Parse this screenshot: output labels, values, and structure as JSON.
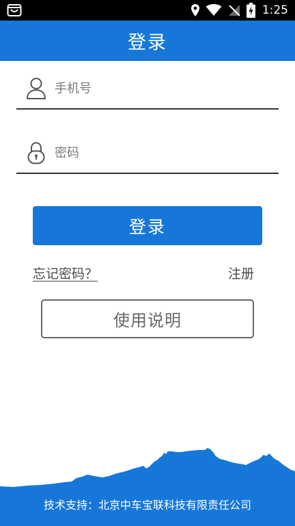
{
  "status_bar": {
    "time": "1:25",
    "icons": [
      "shopping-bag-icon",
      "location-icon",
      "wifi-icon",
      "no-signal-icon",
      "battery-charging-icon"
    ]
  },
  "app_bar": {
    "title": "登录"
  },
  "form": {
    "phone": {
      "placeholder": "手机号",
      "value": "",
      "icon": "user-icon"
    },
    "password": {
      "placeholder": "密码",
      "value": "",
      "icon": "lock-icon"
    }
  },
  "actions": {
    "login_label": "登录",
    "forgot_password_label": "忘记密码？",
    "register_label": "注册",
    "guide_label": "使用说明"
  },
  "footer": {
    "support_text": "技术支持：北京中车宝联科技有限责任公司"
  },
  "colors": {
    "primary": "#1677d9",
    "status_bar": "#000000",
    "text_muted": "#7a7a7a",
    "border": "#333333"
  }
}
